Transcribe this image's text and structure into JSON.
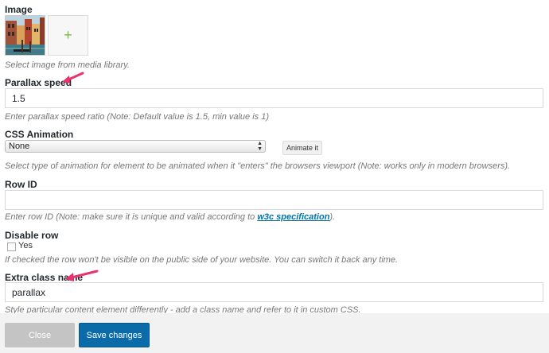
{
  "image": {
    "label": "Image",
    "add_symbol": "+",
    "help": "Select image from media library."
  },
  "parallax_speed": {
    "label": "Parallax speed",
    "value": "1.5",
    "help": "Enter parallax speed ratio (Note: Default value is 1.5, min value is 1)"
  },
  "css_animation": {
    "label": "CSS Animation",
    "selected": "None",
    "button": "Animate it",
    "help": "Select type of animation for element to be animated when it \"enters\" the browsers viewport (Note: works only in modern browsers)."
  },
  "row_id": {
    "label": "Row ID",
    "value": "",
    "help_before": "Enter row ID (Note: make sure it is unique and valid according to ",
    "help_link": "w3c specification",
    "help_after": ")."
  },
  "disable_row": {
    "label": "Disable row",
    "checkbox_label": "Yes",
    "checked": false,
    "help": "If checked the row won't be visible on the public side of your website. You can switch it back any time."
  },
  "extra_class": {
    "label": "Extra class name",
    "value": "parallax",
    "help": "Style particular content element differently - add a class name and refer to it in custom CSS."
  },
  "footer": {
    "close_label": "Close",
    "save_label": "Save changes"
  },
  "colors": {
    "annotation_arrow": "#e8336d",
    "save_button": "#0a6ba8",
    "close_button": "#c4c4c4",
    "link": "#0073aa"
  }
}
